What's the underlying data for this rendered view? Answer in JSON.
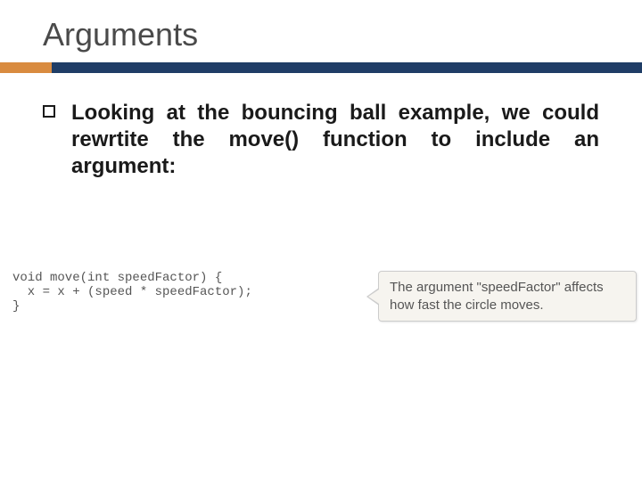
{
  "title": "Arguments",
  "bullet": "Looking at the bouncing ball example, we could rewrtite the move() function to include an argument:",
  "code": {
    "line1": "void move(int speedFactor) {",
    "line2": "  x = x + (speed * speedFactor);",
    "line3": "}"
  },
  "callout": "The argument \"speedFactor\" affects how fast the circle moves."
}
